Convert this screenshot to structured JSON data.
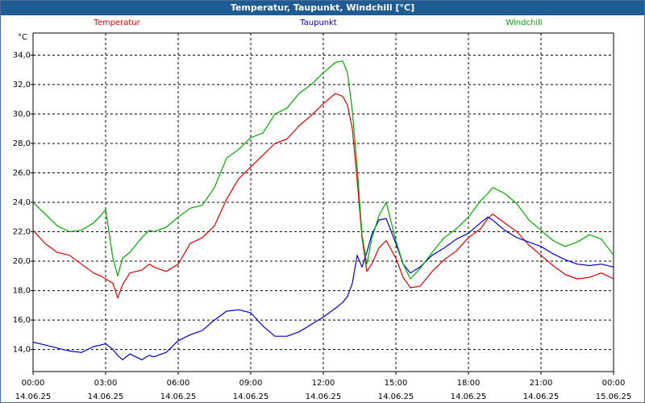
{
  "window": {
    "title": "Temperatur, Taupunkt, Windchill [°C]"
  },
  "chart_data": {
    "type": "line",
    "title": "Temperatur, Taupunkt, Windchill [°C]",
    "ylabel": "°C",
    "xlabel": "",
    "ylim": [
      12.5,
      35.5
    ],
    "xlim": [
      0,
      24
    ],
    "y_ticks": [
      "14,0",
      "16,0",
      "18,0",
      "20,0",
      "22,0",
      "24,0",
      "26,0",
      "28,0",
      "30,0",
      "32,0",
      "34,0"
    ],
    "y_tick_values": [
      14,
      16,
      18,
      20,
      22,
      24,
      26,
      28,
      30,
      32,
      34
    ],
    "x_ticks": [
      {
        "time": "00:00",
        "date": "14.06.25",
        "hour": 0
      },
      {
        "time": "03:00",
        "date": "14.06.25",
        "hour": 3
      },
      {
        "time": "06:00",
        "date": "14.06.25",
        "hour": 6
      },
      {
        "time": "09:00",
        "date": "14.06.25",
        "hour": 9
      },
      {
        "time": "12:00",
        "date": "14.06.25",
        "hour": 12
      },
      {
        "time": "15:00",
        "date": "14.06.25",
        "hour": 15
      },
      {
        "time": "18:00",
        "date": "14.06.25",
        "hour": 18
      },
      {
        "time": "21:00",
        "date": "14.06.25",
        "hour": 21
      },
      {
        "time": "00:00",
        "date": "15.06.25",
        "hour": 24
      }
    ],
    "grid": true,
    "legend_position": "top",
    "series": [
      {
        "name": "Temperatur",
        "color": "#dd0000",
        "x": [
          0,
          0.5,
          1,
          1.5,
          2,
          2.5,
          2.8,
          3,
          3.3,
          3.5,
          3.7,
          4,
          4.5,
          4.8,
          5,
          5.5,
          6,
          6.5,
          7,
          7.5,
          8,
          8.5,
          9,
          9.5,
          10,
          10.5,
          11,
          11.5,
          12,
          12.5,
          12.8,
          13,
          13.2,
          13.4,
          13.6,
          13.8,
          14,
          14.3,
          14.6,
          15,
          15.3,
          15.6,
          16,
          16.5,
          17,
          17.5,
          18,
          18.5,
          18.8,
          19,
          19.5,
          20,
          20.5,
          21,
          21.5,
          22,
          22.5,
          23,
          23.5,
          24
        ],
        "y": [
          22.1,
          21.2,
          20.6,
          20.4,
          19.8,
          19.2,
          19.0,
          18.8,
          18.5,
          17.5,
          18.4,
          19.2,
          19.4,
          19.8,
          19.6,
          19.3,
          19.8,
          21.2,
          21.6,
          22.4,
          24.2,
          25.6,
          26.4,
          27.2,
          28.0,
          28.3,
          29.2,
          29.9,
          30.7,
          31.4,
          31.2,
          30.6,
          29.0,
          25.5,
          21.6,
          19.3,
          19.8,
          20.9,
          21.4,
          20.2,
          18.9,
          18.2,
          18.3,
          19.3,
          20.1,
          20.7,
          21.6,
          22.2,
          22.9,
          23.2,
          22.6,
          22.0,
          21.1,
          20.4,
          19.7,
          19.1,
          18.8,
          18.9,
          19.2,
          18.8
        ]
      },
      {
        "name": "Taupunkt",
        "color": "#0000cc",
        "x": [
          0,
          0.5,
          1,
          1.5,
          2,
          2.5,
          2.8,
          3,
          3.3,
          3.5,
          3.7,
          4,
          4.5,
          4.8,
          5,
          5.5,
          6,
          6.5,
          7,
          7.5,
          8,
          8.5,
          9,
          9.5,
          10,
          10.5,
          11,
          11.5,
          12,
          12.5,
          12.8,
          13,
          13.2,
          13.4,
          13.6,
          13.8,
          14,
          14.3,
          14.6,
          15,
          15.3,
          15.6,
          16,
          16.5,
          17,
          17.5,
          18,
          18.5,
          18.8,
          19,
          19.5,
          20,
          20.5,
          21,
          21.5,
          22,
          22.5,
          23,
          23.5,
          24
        ],
        "y": [
          14.5,
          14.3,
          14.1,
          13.9,
          13.8,
          14.2,
          14.3,
          14.4,
          14.0,
          13.6,
          13.3,
          13.7,
          13.3,
          13.6,
          13.5,
          13.8,
          14.6,
          15.0,
          15.3,
          16.0,
          16.6,
          16.7,
          16.5,
          15.6,
          14.9,
          14.9,
          15.2,
          15.7,
          16.2,
          16.8,
          17.2,
          17.6,
          18.5,
          20.4,
          19.6,
          20.6,
          21.8,
          22.8,
          22.9,
          21.2,
          19.8,
          19.2,
          19.6,
          20.4,
          20.9,
          21.5,
          21.9,
          22.6,
          23.0,
          22.8,
          22.1,
          21.6,
          21.3,
          21.0,
          20.5,
          20.1,
          19.8,
          19.7,
          19.8,
          19.6
        ]
      },
      {
        "name": "Windchill",
        "color": "#00aa00",
        "x": [
          0,
          0.5,
          1,
          1.5,
          2,
          2.5,
          2.8,
          3,
          3.3,
          3.5,
          3.7,
          4,
          4.5,
          4.8,
          5,
          5.5,
          6,
          6.5,
          7,
          7.5,
          8,
          8.5,
          9,
          9.5,
          10,
          10.5,
          11,
          11.5,
          12,
          12.5,
          12.8,
          13,
          13.2,
          13.4,
          13.6,
          13.8,
          14,
          14.3,
          14.6,
          15,
          15.3,
          15.6,
          16,
          16.5,
          17,
          17.5,
          18,
          18.5,
          18.8,
          19,
          19.5,
          20,
          20.5,
          21,
          21.5,
          22,
          22.5,
          23,
          23.5,
          24
        ],
        "y": [
          24.0,
          23.2,
          22.4,
          22.0,
          22.1,
          22.6,
          23.1,
          23.5,
          20.2,
          19.0,
          20.2,
          20.6,
          21.6,
          22.1,
          22.0,
          22.3,
          23.0,
          23.6,
          23.8,
          25.0,
          27.0,
          27.6,
          28.4,
          28.7,
          30.0,
          30.4,
          31.4,
          32.0,
          32.8,
          33.5,
          33.6,
          32.8,
          30.2,
          26.4,
          21.8,
          19.8,
          21.5,
          23.1,
          24.0,
          21.4,
          19.8,
          18.8,
          19.5,
          20.6,
          21.6,
          22.2,
          23.0,
          24.1,
          24.6,
          25.0,
          24.6,
          23.9,
          22.8,
          22.1,
          21.4,
          21.0,
          21.3,
          21.8,
          21.5,
          20.4
        ]
      }
    ]
  }
}
